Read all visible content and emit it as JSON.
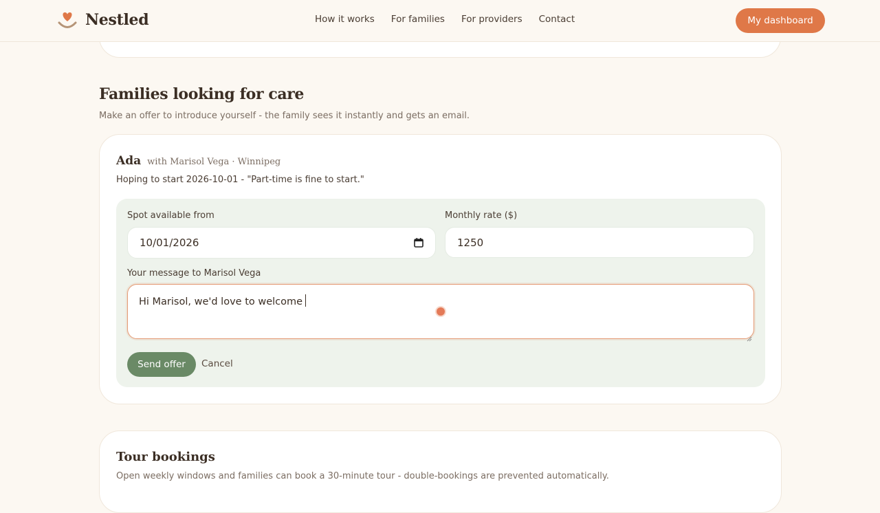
{
  "header": {
    "brand": "Nestled",
    "logo_icon": "heart-smile-icon",
    "nav": [
      "How it works",
      "For families",
      "For providers",
      "Contact"
    ],
    "dashboard_button": "My dashboard"
  },
  "families_section": {
    "title": "Families looking for care",
    "subtitle": "Make an offer to introduce yourself - the family sees it instantly and gets an email."
  },
  "request": {
    "child_name": "Ada",
    "meta": "with Marisol Vega · Winnipeg",
    "note": "Hoping to start 2026-10-01 - \"Part-time is fine to start.\""
  },
  "offer_form": {
    "spot_label": "Spot available from",
    "spot_value": "10/01/2026",
    "rate_label": "Monthly rate ($)",
    "rate_value": "1250",
    "message_label": "Your message to Marisol Vega",
    "message_value": "Hi Marisol, we'd love to welcome",
    "send_button": "Send offer",
    "cancel_button": "Cancel"
  },
  "tour_section": {
    "title": "Tour bookings",
    "subtitle": "Open weekly windows and families can book a 30-minute tour - double-bookings are prevented automatically."
  },
  "colors": {
    "accent": "#df7848",
    "primary_green": "#6a8a66",
    "panel_bg": "#eef3ec",
    "page_bg": "#fcf8f2"
  }
}
